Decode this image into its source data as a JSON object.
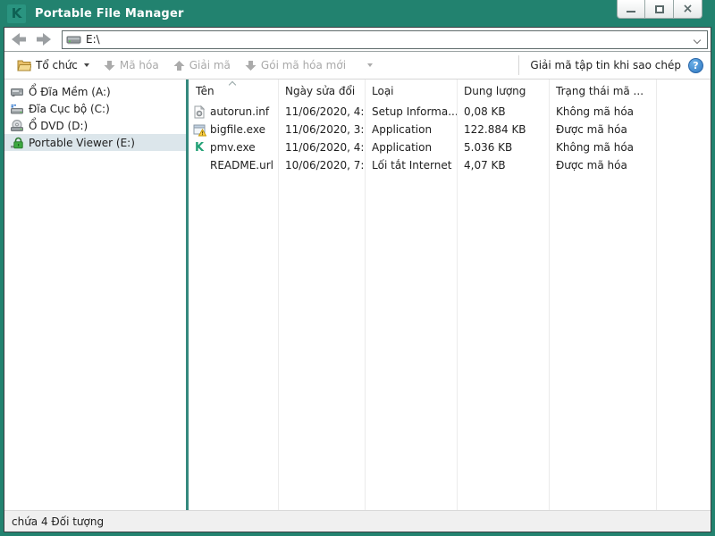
{
  "window": {
    "title": "Portable File Manager"
  },
  "icons": {
    "logo": "K",
    "close": "×",
    "help": "?",
    "kaspersky_k": "K"
  },
  "navbar": {
    "address": "E:\\"
  },
  "toolbar": {
    "organize": "Tổ chức",
    "encrypt": "Mã hóa",
    "decrypt": "Giải mã",
    "new_package": "Gói mã hóa mới",
    "decrypt_on_copy": "Giải mã tập tin khi sao chép"
  },
  "sidebar": {
    "items": [
      {
        "label": "Ổ Đĩa Mềm (A:)",
        "icon": "floppy-drive-icon",
        "selected": false
      },
      {
        "label": "Đĩa Cục bộ (C:)",
        "icon": "local-disk-icon",
        "selected": false
      },
      {
        "label": "Ổ DVD (D:)",
        "icon": "dvd-drive-icon",
        "selected": false
      },
      {
        "label": "Portable Viewer (E:)",
        "icon": "locked-drive-icon",
        "selected": true
      }
    ]
  },
  "table": {
    "columns": [
      {
        "label": "Tên",
        "sorted": "asc"
      },
      {
        "label": "Ngày sửa đổi"
      },
      {
        "label": "Loại"
      },
      {
        "label": "Dung lượng"
      },
      {
        "label": "Trạng thái mã ..."
      }
    ],
    "rows": [
      {
        "icon": "inf-file-icon",
        "name": "autorun.inf",
        "modified": "11/06/2020, 4:...",
        "type": "Setup Informa...",
        "size": "0,08 KB",
        "status": "Không mã hóa"
      },
      {
        "icon": "exe-file-icon",
        "name": "bigfile.exe",
        "modified": "11/06/2020, 3:...",
        "type": "Application",
        "size": "122.884 KB",
        "status": "Được mã hóa"
      },
      {
        "icon": "kaspersky-app-icon",
        "name": "pmv.exe",
        "modified": "11/06/2020, 4:...",
        "type": "Application",
        "size": "5.036 KB",
        "status": "Không mã hóa"
      },
      {
        "icon": "none",
        "name": "README.url",
        "modified": "10/06/2020, 7:...",
        "type": "Lối tắt Internet",
        "size": "4,07 KB",
        "status": "Được mã hóa"
      }
    ]
  },
  "statusbar": {
    "text": "chứa 4 Đối tượng"
  },
  "colors": {
    "titlebar": "#22826F",
    "panel_separator": "#35897E",
    "selected_row": "#DCE6EB",
    "disabled_text": "#A9A9A9",
    "help_blue": "#2F77C0",
    "kaspersky_green": "#23A176"
  }
}
